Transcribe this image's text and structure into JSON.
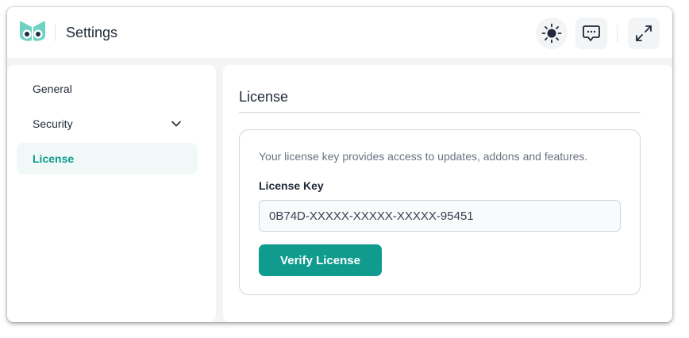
{
  "header": {
    "title": "Settings",
    "icons": [
      "logo-icon",
      "sun-icon",
      "chat-bubble-icon",
      "expand-icon"
    ]
  },
  "sidebar": {
    "items": [
      {
        "label": "General",
        "active": false
      },
      {
        "label": "Security",
        "active": false,
        "expandable": true
      },
      {
        "label": "License",
        "active": true
      }
    ]
  },
  "main": {
    "title": "License",
    "description": "Your license key provides access to updates, addons and features.",
    "field_label": "License Key",
    "license_value": "0B74D-XXXXX-XXXXX-XXXXX-95451",
    "verify_label": "Verify License"
  },
  "colors": {
    "accent": "#0f9b8e",
    "active_bg": "#f0f9f7",
    "app_bg": "#f3f4f6"
  }
}
